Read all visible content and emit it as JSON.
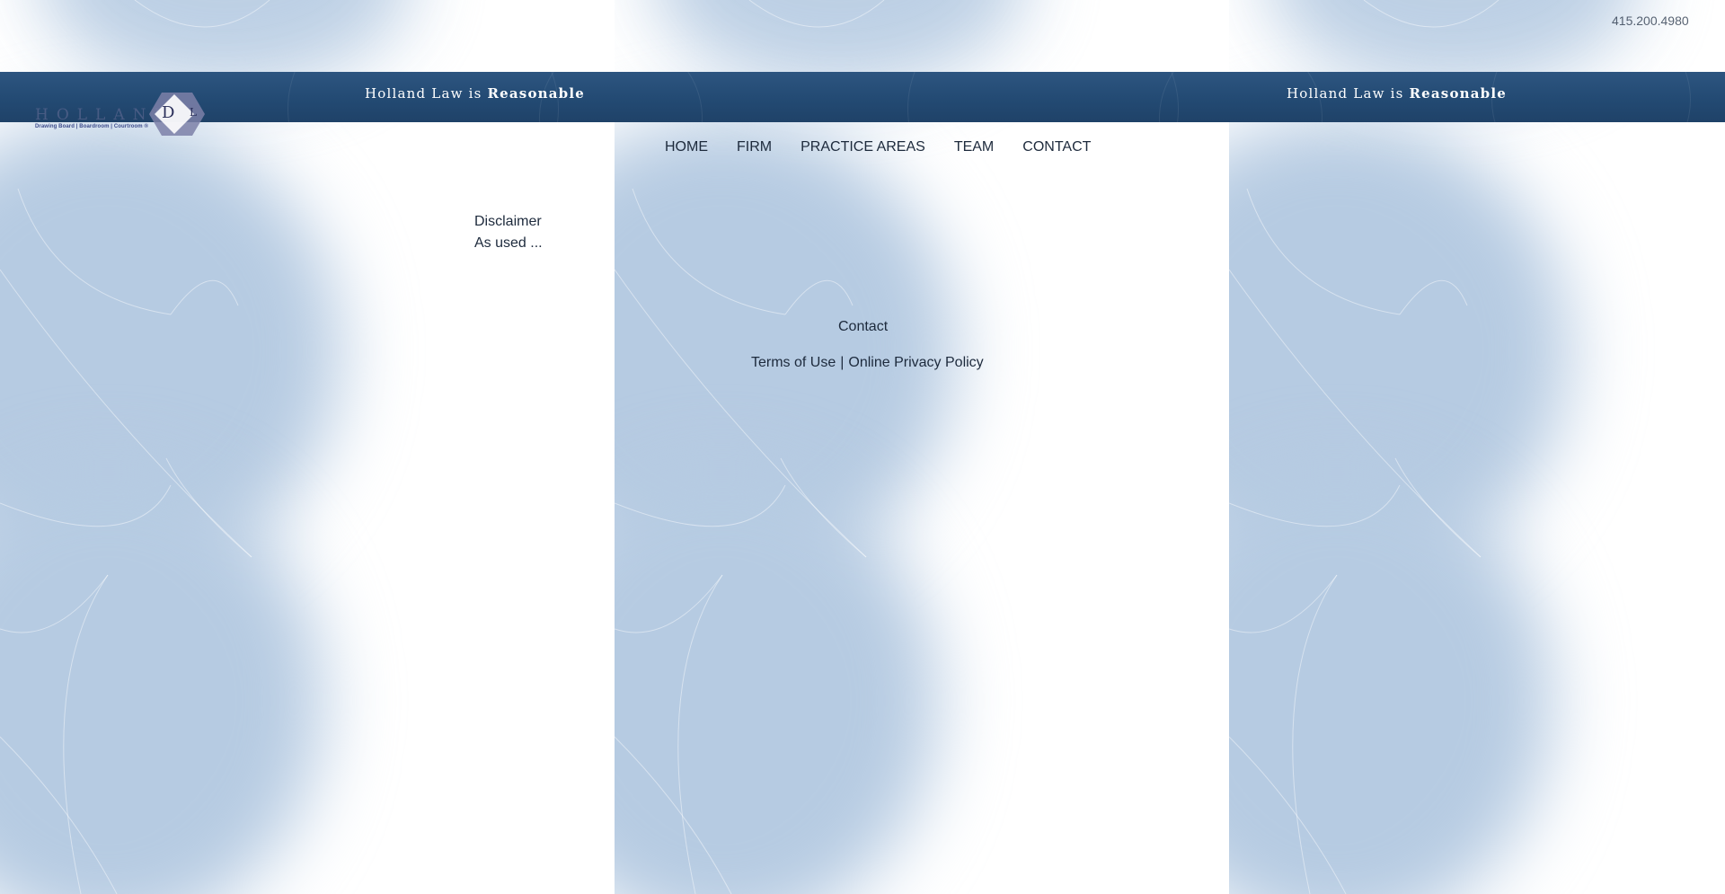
{
  "header": {
    "tagline_prefix": "Holland Law is ",
    "tagline_emphasis": "Reasonable",
    "phone": "415.200.4980"
  },
  "logo": {
    "wordmark": "HOLLAND",
    "subtitle": "Drawing Board | Boardroom | Courtroom ®",
    "monogram_d": "D",
    "monogram_l": "L"
  },
  "nav": {
    "items": [
      {
        "label": "HOME"
      },
      {
        "label": "FIRM"
      },
      {
        "label": "PRACTICE AREAS"
      },
      {
        "label": "TEAM"
      },
      {
        "label": "CONTACT"
      }
    ]
  },
  "content": {
    "disclaimer_title": "Disclaimer",
    "disclaimer_excerpt": "As used ..."
  },
  "footer": {
    "contact_label": "Contact",
    "terms_label": "Terms of Use",
    "separator": "|",
    "privacy_label": "Online Privacy Policy"
  },
  "colors": {
    "header_band": "#234a73",
    "background_blue": "#b6cbe2",
    "text": "#1d2a3c"
  }
}
